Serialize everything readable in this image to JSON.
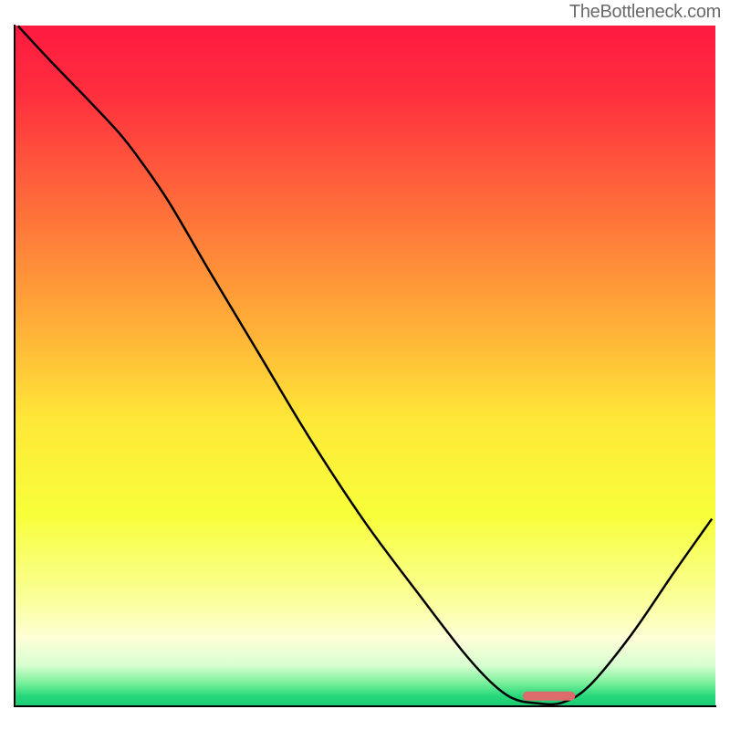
{
  "watermark": "TheBottleneck.com",
  "chart_data": {
    "type": "line",
    "title": "",
    "xlabel": "",
    "ylabel": "",
    "x_range": [
      0,
      100
    ],
    "y_range": [
      0,
      100
    ],
    "gradient": {
      "stops": [
        {
          "offset": 0.0,
          "color": "#ff1a40"
        },
        {
          "offset": 0.1,
          "color": "#ff2e3e"
        },
        {
          "offset": 0.3,
          "color": "#ff7a3a"
        },
        {
          "offset": 0.45,
          "color": "#ffb238"
        },
        {
          "offset": 0.58,
          "color": "#ffe838"
        },
        {
          "offset": 0.72,
          "color": "#f7ff3a"
        },
        {
          "offset": 0.85,
          "color": "#fbffa0"
        },
        {
          "offset": 0.9,
          "color": "#feffd8"
        },
        {
          "offset": 0.94,
          "color": "#d8ffd0"
        },
        {
          "offset": 0.965,
          "color": "#7cf09c"
        },
        {
          "offset": 0.985,
          "color": "#26d87a"
        },
        {
          "offset": 1.0,
          "color": "#1acc70"
        }
      ]
    },
    "series": [
      {
        "name": "bottleneck-curve",
        "points": [
          {
            "x": 0.5,
            "y": 99.8
          },
          {
            "x": 5,
            "y": 94.8
          },
          {
            "x": 10,
            "y": 89.5
          },
          {
            "x": 15,
            "y": 84.0
          },
          {
            "x": 18,
            "y": 80.0
          },
          {
            "x": 22,
            "y": 74.0
          },
          {
            "x": 28,
            "y": 63.5
          },
          {
            "x": 35,
            "y": 51.5
          },
          {
            "x": 42,
            "y": 39.5
          },
          {
            "x": 50,
            "y": 27.0
          },
          {
            "x": 58,
            "y": 16.0
          },
          {
            "x": 64,
            "y": 8.0
          },
          {
            "x": 68,
            "y": 3.5
          },
          {
            "x": 71,
            "y": 1.2
          },
          {
            "x": 74,
            "y": 0.5
          },
          {
            "x": 78,
            "y": 0.5
          },
          {
            "x": 82,
            "y": 3.0
          },
          {
            "x": 88,
            "y": 10.5
          },
          {
            "x": 94,
            "y": 19.5
          },
          {
            "x": 99.5,
            "y": 27.5
          }
        ]
      }
    ],
    "marker": {
      "x_start": 72.5,
      "x_end": 80,
      "y": 1.5,
      "color": "#dd6b6b"
    }
  }
}
